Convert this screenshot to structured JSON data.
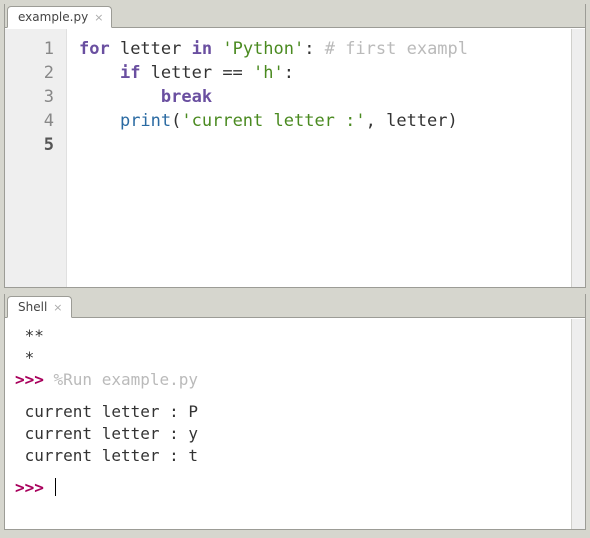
{
  "editor": {
    "tab_label": "example.py",
    "lines": [
      {
        "n": "1",
        "tokens": [
          {
            "t": "for",
            "c": "kw"
          },
          {
            "t": " letter ",
            "c": "op"
          },
          {
            "t": "in",
            "c": "kw"
          },
          {
            "t": " ",
            "c": "op"
          },
          {
            "t": "'Python'",
            "c": "str"
          },
          {
            "t": ": ",
            "c": "op"
          },
          {
            "t": "# first exampl",
            "c": "comment"
          }
        ]
      },
      {
        "n": "2",
        "tokens": [
          {
            "t": "    ",
            "c": "op"
          },
          {
            "t": "if",
            "c": "kw"
          },
          {
            "t": " letter == ",
            "c": "op"
          },
          {
            "t": "'h'",
            "c": "str"
          },
          {
            "t": ":",
            "c": "op"
          }
        ]
      },
      {
        "n": "3",
        "tokens": [
          {
            "t": "        ",
            "c": "op"
          },
          {
            "t": "break",
            "c": "kw"
          }
        ]
      },
      {
        "n": "4",
        "tokens": [
          {
            "t": "    ",
            "c": "op"
          },
          {
            "t": "print",
            "c": "builtin"
          },
          {
            "t": "(",
            "c": "op"
          },
          {
            "t": "'current letter :'",
            "c": "str"
          },
          {
            "t": ", letter)",
            "c": "op"
          }
        ]
      },
      {
        "n": "5",
        "tokens": [],
        "active": true
      }
    ]
  },
  "shell": {
    "tab_label": "Shell",
    "lines": [
      {
        "kind": "plain",
        "text": " **"
      },
      {
        "kind": "plain",
        "text": " *"
      },
      {
        "kind": "prompt_cmd",
        "prompt": ">>> ",
        "cmd": "%Run example.py"
      },
      {
        "kind": "blank",
        "text": ""
      },
      {
        "kind": "plain",
        "text": " current letter : P"
      },
      {
        "kind": "plain",
        "text": " current letter : y"
      },
      {
        "kind": "plain",
        "text": " current letter : t"
      },
      {
        "kind": "blank",
        "text": ""
      },
      {
        "kind": "prompt_input",
        "prompt": ">>> "
      }
    ]
  }
}
